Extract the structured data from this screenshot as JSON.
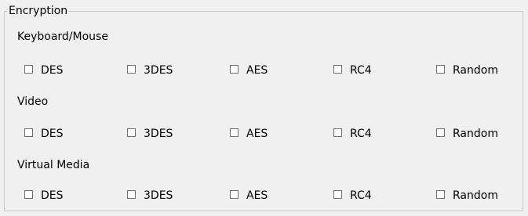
{
  "group_title": "Encryption",
  "sections": [
    {
      "label": "Keyboard/Mouse",
      "options": [
        {
          "label": "DES",
          "checked": false
        },
        {
          "label": "3DES",
          "checked": false
        },
        {
          "label": "AES",
          "checked": false
        },
        {
          "label": "RC4",
          "checked": false
        },
        {
          "label": "Random",
          "checked": false
        }
      ]
    },
    {
      "label": "Video",
      "options": [
        {
          "label": "DES",
          "checked": false
        },
        {
          "label": "3DES",
          "checked": false
        },
        {
          "label": "AES",
          "checked": false
        },
        {
          "label": "RC4",
          "checked": false
        },
        {
          "label": "Random",
          "checked": false
        }
      ]
    },
    {
      "label": "Virtual Media",
      "options": [
        {
          "label": "DES",
          "checked": false
        },
        {
          "label": "3DES",
          "checked": false
        },
        {
          "label": "AES",
          "checked": false
        },
        {
          "label": "RC4",
          "checked": false
        },
        {
          "label": "Random",
          "checked": false
        }
      ]
    }
  ]
}
